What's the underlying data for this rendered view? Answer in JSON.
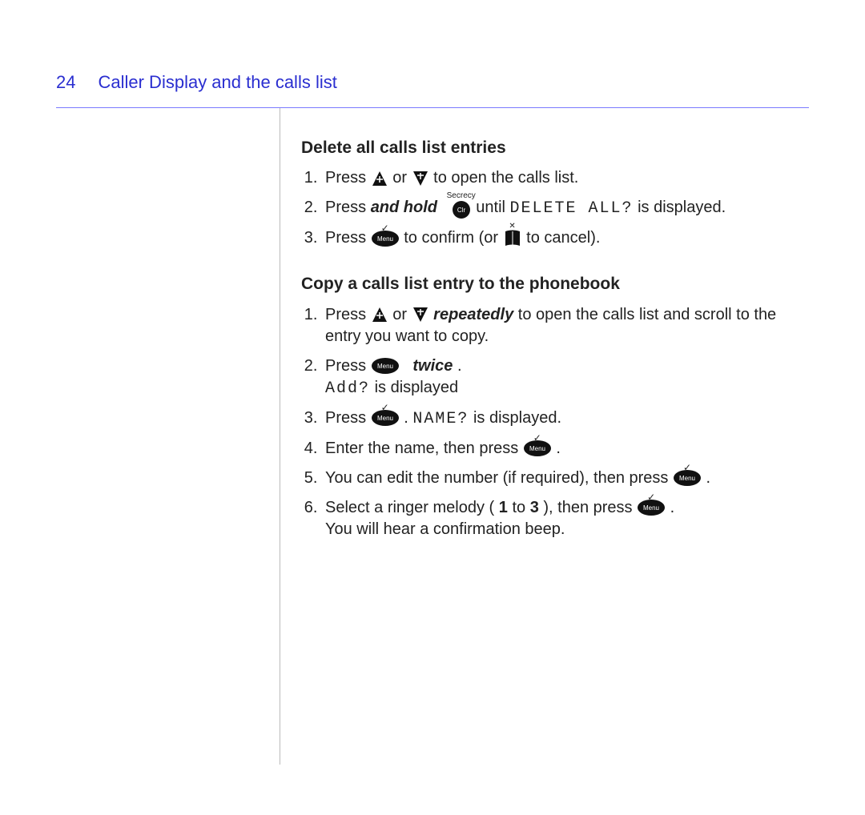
{
  "page_number": "24",
  "section_title": "Caller Display and the calls list",
  "sections": {
    "delete": {
      "heading": "Delete all calls list entries",
      "s1a": "Press ",
      "s1b": " or ",
      "s1c": " to open the calls list.",
      "s2a": "Press ",
      "s2_emph": "and hold",
      "s2b": " until ",
      "s2_mono": "DELETE ALL?",
      "s2c": " is displayed.",
      "s3a": "Press ",
      "s3b": " to confirm (or ",
      "s3c": " to cancel).",
      "clr_label": "Secrecy"
    },
    "copy": {
      "heading": "Copy a calls list entry to the phonebook",
      "s1a": "Press ",
      "s1b": " or ",
      "s1c": " ",
      "s1_emph": "repeatedly",
      "s1d": " to open the calls list and scroll to the entry you want to copy.",
      "s2a": "Press ",
      "s2_emph": "twice",
      "s2b": ".",
      "s2_line2a": "",
      "s2_mono": "Add?",
      "s2_line2b": " is displayed",
      "s3a": "Press ",
      "s3b": ". ",
      "s3_mono": "NAME?",
      "s3c": " is displayed.",
      "s4a": "Enter the name, then press ",
      "s4b": ".",
      "s5a": "You can edit the number (if required), then press ",
      "s5b": ".",
      "s6a": "Select a ringer melody (",
      "s6_b1": "1",
      "s6b": " to ",
      "s6_b3": "3",
      "s6c": "), then press ",
      "s6d": ".",
      "s6_line2": "You will hear a confirmation beep."
    }
  }
}
